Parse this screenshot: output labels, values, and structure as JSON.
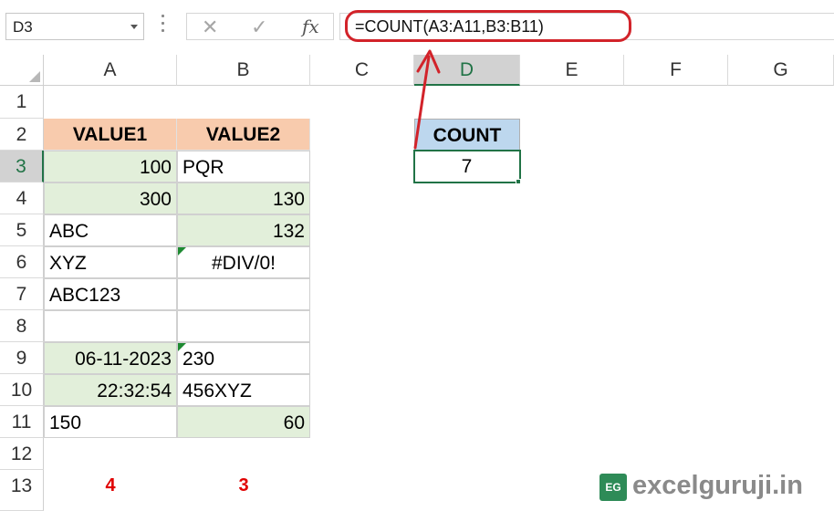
{
  "formula_bar": {
    "name_box": "D3",
    "fx_label": "fx",
    "formula": "=COUNT(A3:A11,B3:B11)"
  },
  "columns": [
    "A",
    "B",
    "C",
    "D",
    "E",
    "F",
    "G"
  ],
  "rows": [
    "1",
    "2",
    "3",
    "4",
    "5",
    "6",
    "7",
    "8",
    "9",
    "10",
    "11",
    "12",
    "13"
  ],
  "selected_column": "D",
  "selected_row": "3",
  "cells": {
    "A2": "VALUE1",
    "B2": "VALUE2",
    "A3": "100",
    "B3": "PQR",
    "A4": "300",
    "B4": "130",
    "A5": "ABC",
    "B5": "132",
    "A6": "XYZ",
    "B6": "#DIV/0!",
    "A7": "ABC123",
    "B7": "",
    "A8": "",
    "B8": "",
    "A9": "06-11-2023",
    "B9": "230",
    "A10": "22:32:54",
    "B10": "456XYZ",
    "A11": "150",
    "B11": "60",
    "A13": "4",
    "B13": "3",
    "D2": "COUNT",
    "D3": "7"
  },
  "colors": {
    "header_fill": "#f8cbad",
    "numeric_fill": "#e2efda",
    "count_header_fill": "#bdd7ee",
    "annotation_red": "#d2232a",
    "excel_green": "#217346"
  },
  "logo": {
    "mark": "EG",
    "text": "excelguruji.in"
  }
}
